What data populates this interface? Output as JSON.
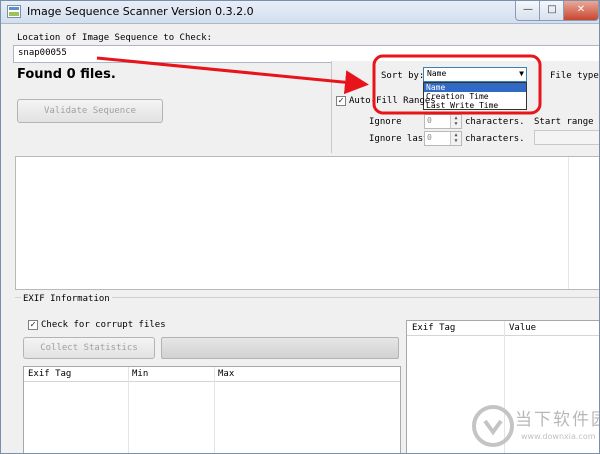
{
  "window": {
    "title": "Image Sequence Scanner Version 0.3.2.0",
    "min_glyph": "—",
    "max_glyph": "□",
    "close_glyph": "✕"
  },
  "location": {
    "label": "Location of Image Sequence to Check:",
    "value": "snap00055"
  },
  "status": {
    "found_text": "Found 0 files."
  },
  "validate_button": "Validate Sequence",
  "sort": {
    "label": "Sort by:",
    "selected": "Name",
    "options": [
      "Name",
      "Creation Time",
      "Last Write Time"
    ]
  },
  "file_types_label": "File types",
  "auto_fill": {
    "label": "Auto-Fill Ranges",
    "checked": true
  },
  "ignore_first": {
    "label": "Ignore",
    "value": "0",
    "suffix": "characters."
  },
  "ignore_last": {
    "label": "Ignore last",
    "value": "0",
    "suffix": "characters."
  },
  "start_range_label": "Start range #:",
  "exif": {
    "group_label": "EXIF Information",
    "corrupt_check_label": "Check for corrupt files",
    "corrupt_checked": true,
    "collect_button": "Collect Statistics",
    "stats_columns": [
      "Exif Tag",
      "Min",
      "Max"
    ],
    "detail_columns": [
      "Exif Tag",
      "Value"
    ]
  },
  "watermark": {
    "text": "当下软件园",
    "url": "www.downxia.com"
  },
  "colors": {
    "annotation": "#e8141c",
    "selection": "#316ac5"
  }
}
